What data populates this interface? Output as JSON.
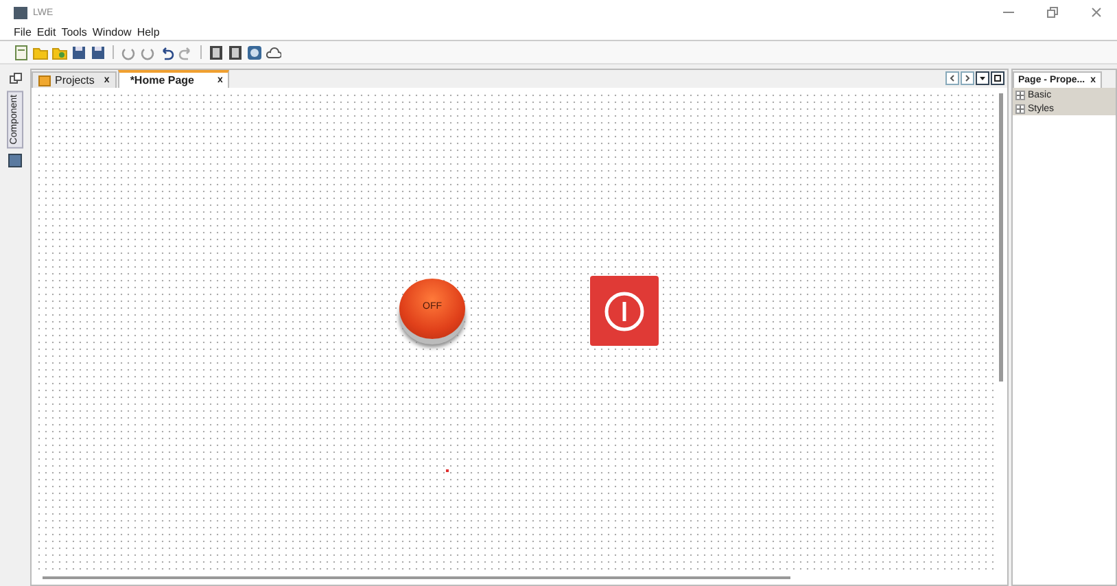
{
  "window": {
    "title": "LWE"
  },
  "menu": [
    "File",
    "Edit",
    "Tools",
    "Window",
    "Help"
  ],
  "side_strip": {
    "label": "Component"
  },
  "editor_tabs": [
    {
      "label": "Projects",
      "close": "x",
      "selected": false
    },
    {
      "label": "*Home Page",
      "close": "x",
      "selected": true
    }
  ],
  "canvas": {
    "widgets": [
      {
        "kind": "push_button",
        "label": "OFF"
      },
      {
        "kind": "power_button"
      }
    ]
  },
  "properties": {
    "tab": {
      "label": "Page - Prope...",
      "close": "x"
    },
    "items": [
      {
        "label": "Basic",
        "expanded": false
      },
      {
        "label": "Styles",
        "expanded": false
      }
    ]
  }
}
